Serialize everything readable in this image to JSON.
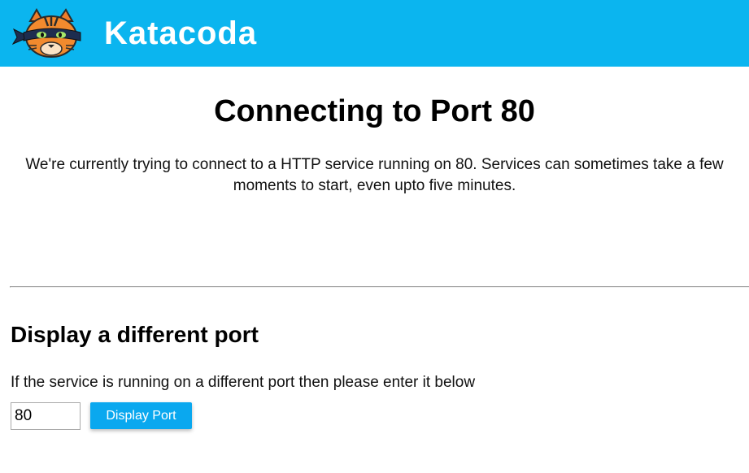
{
  "header": {
    "brand_name": "Katacoda",
    "logo_icon": "ninja-cat-mascot-icon",
    "background_color": "#0bb5ef"
  },
  "main": {
    "title": "Connecting to Port 80",
    "description": "We're currently trying to connect to a HTTP service running on 80. Services can sometimes take a few moments to start, even upto five minutes."
  },
  "port_section": {
    "title": "Display a different port",
    "description": "If the service is running on a different port then please enter it below",
    "port_value": "80",
    "button_label": "Display Port",
    "button_color": "#0aa8ef"
  }
}
